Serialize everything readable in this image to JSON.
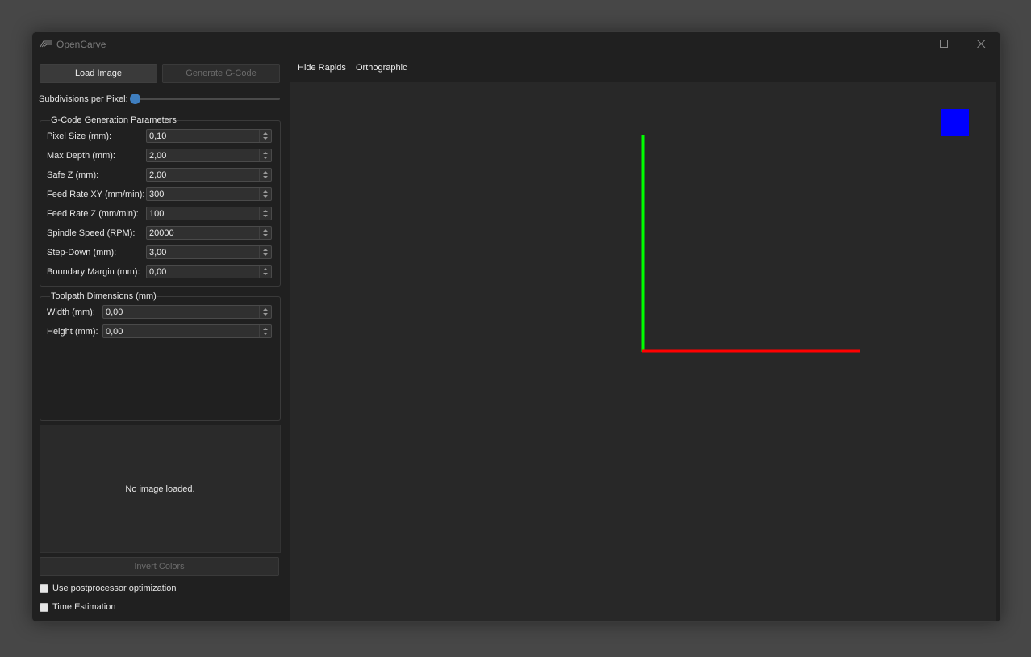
{
  "window": {
    "title": "OpenCarve"
  },
  "toolbar": {
    "load_image": "Load Image",
    "generate_gcode": "Generate G-Code"
  },
  "subdivisions": {
    "label": "Subdivisions per Pixel:",
    "value": 0
  },
  "gcode_params": {
    "title": "G-Code Generation Parameters",
    "fields": [
      {
        "label": "Pixel Size (mm):",
        "value": "0,10"
      },
      {
        "label": "Max Depth (mm):",
        "value": "2,00"
      },
      {
        "label": "Safe Z (mm):",
        "value": "2,00"
      },
      {
        "label": "Feed Rate XY (mm/min):",
        "value": "300"
      },
      {
        "label": "Feed Rate Z (mm/min):",
        "value": "100"
      },
      {
        "label": "Spindle Speed (RPM):",
        "value": "20000"
      },
      {
        "label": "Step-Down (mm):",
        "value": "3,00"
      },
      {
        "label": "Boundary Margin (mm):",
        "value": "0,00"
      }
    ]
  },
  "toolpath_dims": {
    "title": "Toolpath Dimensions (mm)",
    "fields": [
      {
        "label": "Width (mm):",
        "value": "0,00"
      },
      {
        "label": "Height (mm):",
        "value": "0,00"
      }
    ]
  },
  "preview": {
    "text": "No image loaded."
  },
  "invert_colors": "Invert Colors",
  "options": {
    "postprocessor": {
      "label": "Use postprocessor optimization",
      "checked": false
    },
    "time_estimation": {
      "label": "Time Estimation",
      "checked": false
    }
  },
  "viewport": {
    "menu": {
      "hide_rapids": "Hide Rapids",
      "orthographic": "Orthographic"
    },
    "axis_colors": {
      "x": "#ff0000",
      "y": "#00ff00",
      "z": "#0000ff"
    }
  },
  "icons": [
    "app-logo-icon",
    "minimize-icon",
    "maximize-icon",
    "close-icon"
  ]
}
